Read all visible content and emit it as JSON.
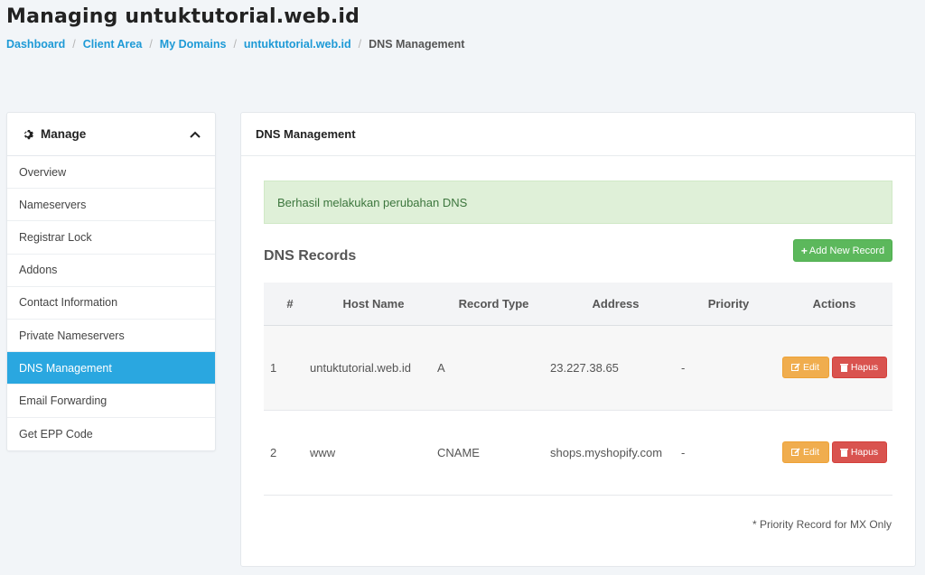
{
  "page": {
    "title": "Managing untuktutorial.web.id",
    "breadcrumb": [
      "Dashboard",
      "Client Area",
      "My Domains",
      "untuktutorial.web.id",
      "DNS Management"
    ]
  },
  "sidebar": {
    "title": "Manage",
    "items": [
      {
        "label": "Overview"
      },
      {
        "label": "Nameservers"
      },
      {
        "label": "Registrar Lock"
      },
      {
        "label": "Addons"
      },
      {
        "label": "Contact Information"
      },
      {
        "label": "Private Nameservers"
      },
      {
        "label": "DNS Management",
        "active": true
      },
      {
        "label": "Email Forwarding"
      },
      {
        "label": "Get EPP Code"
      }
    ]
  },
  "main": {
    "panel_title": "DNS Management",
    "alert": "Berhasil melakukan perubahan DNS",
    "section_title": "DNS Records",
    "add_button": "Add New Record",
    "table": {
      "headers": [
        "#",
        "Host Name",
        "Record Type",
        "Address",
        "Priority",
        "Actions"
      ],
      "rows": [
        {
          "num": "1",
          "host": "untuktutorial.web.id",
          "type": "A",
          "address": "23.227.38.65",
          "priority": "-"
        },
        {
          "num": "2",
          "host": "www",
          "type": "CNAME",
          "address": "shops.myshopify.com",
          "priority": "-"
        }
      ],
      "edit_label": "Edit",
      "delete_label": "Hapus"
    },
    "footnote": "* Priority Record for MX Only"
  },
  "colors": {
    "accent": "#2aa7e0",
    "link": "#1e9ad6",
    "success": "#5cb85c",
    "warning": "#f0ad4e",
    "danger": "#d9534f",
    "alert_bg": "#dff0d8"
  },
  "icons": {
    "sidebar_header": "gear-icon",
    "collapse": "chevron-up-icon",
    "add": "plus-icon",
    "edit": "edit-icon",
    "delete": "trash-icon"
  }
}
